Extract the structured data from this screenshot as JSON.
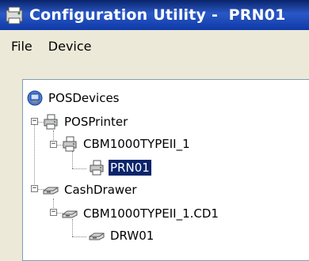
{
  "window": {
    "title": "Configuration Utility -  PRN01",
    "icon": "app-window-icon"
  },
  "menu": {
    "items": [
      "File",
      "Device"
    ]
  },
  "tree": {
    "root": {
      "label": "POSDevices",
      "icon": "computer-icon"
    },
    "pos_printer": {
      "label": "POSPrinter",
      "icon": "printer-icon",
      "expander": "−"
    },
    "printer_device": {
      "label": "CBM1000TYPEII_1",
      "icon": "printer-icon",
      "expander": "−"
    },
    "printer_logical": {
      "label": "PRN01",
      "icon": "printer-icon",
      "selected": true
    },
    "cash_drawer": {
      "label": "CashDrawer",
      "icon": "cash-drawer-icon",
      "expander": "−"
    },
    "drawer_device": {
      "label": "CBM1000TYPEII_1.CD1",
      "icon": "cash-drawer-icon",
      "expander": "−"
    },
    "drawer_logical": {
      "label": "DRW01",
      "icon": "cash-drawer-icon"
    }
  },
  "colors": {
    "titlebar": "#0a246a",
    "selection": "#0a246a",
    "window_bg": "#ece9d8"
  }
}
